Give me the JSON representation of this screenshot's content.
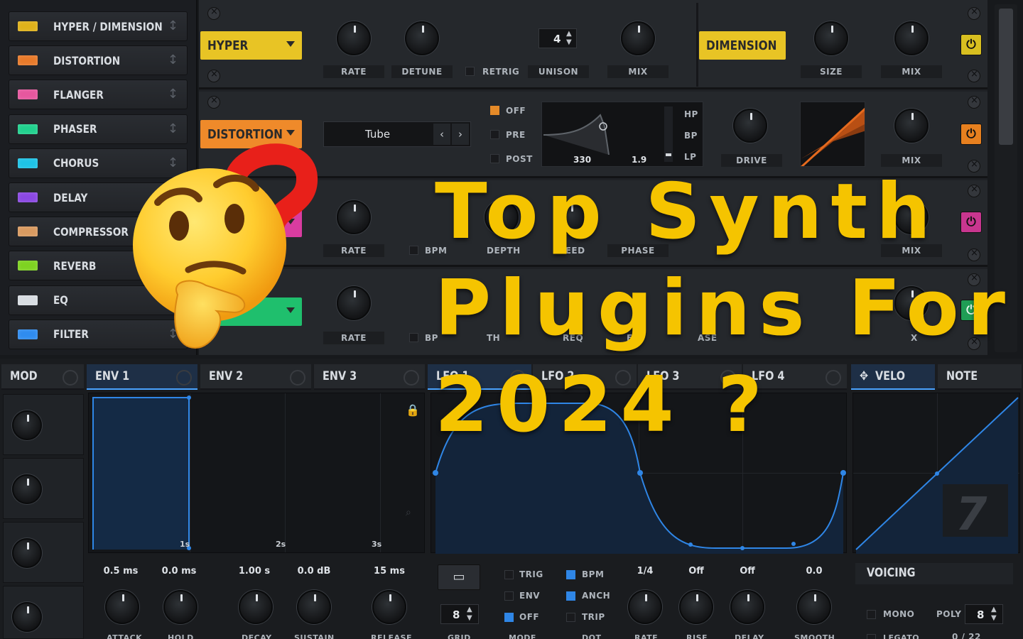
{
  "fx_list": [
    {
      "label": "HYPER / DIMENSION",
      "color": "#e0b21a"
    },
    {
      "label": "DISTORTION",
      "color": "#e87a2a"
    },
    {
      "label": "FLANGER",
      "color": "#e6579e"
    },
    {
      "label": "PHASER",
      "color": "#21d18e"
    },
    {
      "label": "CHORUS",
      "color": "#1ec3e6"
    },
    {
      "label": "DELAY",
      "color": "#8b48e3"
    },
    {
      "label": "COMPRESSOR",
      "color": "#d99a60"
    },
    {
      "label": "REVERB",
      "color": "#7ed321"
    },
    {
      "label": "EQ",
      "color": "#d8dde2"
    },
    {
      "label": "FILTER",
      "color": "#2f8cf0"
    }
  ],
  "hyper": {
    "name": "HYPER",
    "rate_label": "RATE",
    "detune_label": "DETUNE",
    "retrig_label": "RETRIG",
    "unison_label": "UNISON",
    "unison_value": "4",
    "mix_label": "MIX"
  },
  "dimension": {
    "name": "DIMENSION",
    "size_label": "SIZE",
    "mix_label": "MIX"
  },
  "distortion": {
    "name": "DISTORTION",
    "type": "Tube",
    "off_label": "OFF",
    "pre_label": "PRE",
    "post_label": "POST",
    "freq_value": "330",
    "q_value": "1.9",
    "hp_label": "HP",
    "bp_label": "BP",
    "lp_label": "LP",
    "drive_label": "DRIVE",
    "mix_label": "MIX"
  },
  "flanger": {
    "rate_label": "RATE",
    "bpm_label": "BPM",
    "depth_label": "DEPTH",
    "feed_label": "FEED",
    "phase_label": "PHASE",
    "mix_label": "MIX"
  },
  "phaser": {
    "rate_label": "RATE",
    "bpm_label": "BP",
    "depth_label": "TH",
    "freq_label": "REQ",
    "feed_label": "FE",
    "phase_label": "ASE",
    "mix_label": "X"
  },
  "tabs": {
    "mod": "MOD",
    "env1": "ENV 1",
    "env2": "ENV 2",
    "env3": "ENV 3",
    "lfo1": "LFO 1",
    "lfo2": "LFO 2",
    "lfo3": "LFO 3",
    "lfo4": "LFO 4",
    "velo": "VELO",
    "note": "NOTE"
  },
  "env": {
    "markers": [
      "1s",
      "2s",
      "3s"
    ],
    "values": [
      "0.5 ms",
      "0.0 ms",
      "1.00 s",
      "0.0 dB",
      "15 ms"
    ],
    "labels": [
      "ATTACK",
      "HOLD",
      "DECAY",
      "SUSTAIN",
      "RELEASE"
    ]
  },
  "lfo": {
    "grid_value": "8",
    "grid_label": "GRID",
    "mode_label": "MODE",
    "trig_label": "TRIG",
    "env_label": "ENV",
    "off_label": "OFF",
    "bpm_label": "BPM",
    "anch_label": "ANCH",
    "trip_label": "TRIP",
    "dot_label": "DOT",
    "values": [
      "1/4",
      "Off",
      "Off",
      "0.0"
    ],
    "knob_labels": [
      "RATE",
      "RISE",
      "DELAY",
      "SMOOTH"
    ]
  },
  "voicing": {
    "title": "VOICING",
    "mono_label": "MONO",
    "poly_label": "POLY",
    "poly_value": "8",
    "legato_label": "LEGATO",
    "legato_value": "0 / 22"
  },
  "overlay": {
    "line1": "Top Synth",
    "line2": "Plugins For",
    "line3": "2024 ?",
    "color": "#f5c400"
  }
}
